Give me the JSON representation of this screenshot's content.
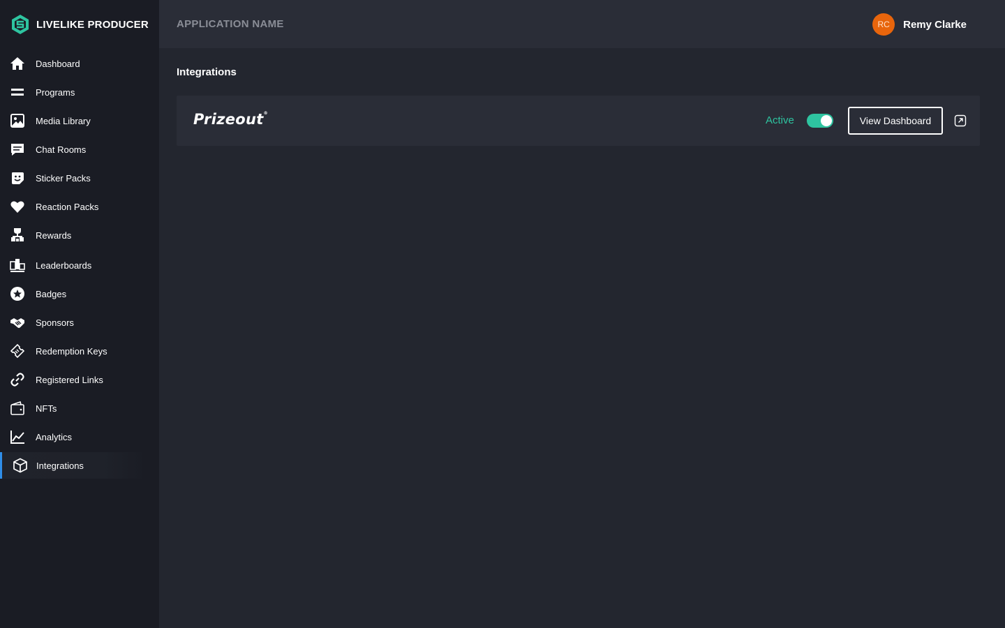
{
  "brand": {
    "name": "LIVELIKE PRODUCER",
    "accent": "#2ec4a0"
  },
  "header": {
    "app_name": "APPLICATION NAME",
    "user_initials": "RC",
    "user_name": "Remy Clarke",
    "avatar_color": "#e8650c"
  },
  "sidebar": {
    "items": [
      {
        "label": "Dashboard",
        "icon": "home-icon"
      },
      {
        "label": "Programs",
        "icon": "programs-icon"
      },
      {
        "label": "Media Library",
        "icon": "image-icon"
      },
      {
        "label": "Chat Rooms",
        "icon": "chat-icon"
      },
      {
        "label": "Sticker Packs",
        "icon": "sticker-icon"
      },
      {
        "label": "Reaction Packs",
        "icon": "heart-icon"
      },
      {
        "label": "Rewards",
        "icon": "rewards-icon"
      },
      {
        "label": "Leaderboards",
        "icon": "leaderboard-icon"
      },
      {
        "label": "Badges",
        "icon": "badge-icon"
      },
      {
        "label": "Sponsors",
        "icon": "handshake-icon"
      },
      {
        "label": "Redemption Keys",
        "icon": "ticket-icon"
      },
      {
        "label": "Registered Links",
        "icon": "link-icon"
      },
      {
        "label": "NFTs",
        "icon": "wallet-icon"
      },
      {
        "label": "Analytics",
        "icon": "chart-line-icon"
      },
      {
        "label": "Integrations",
        "icon": "cube-icon",
        "active": true
      }
    ]
  },
  "main": {
    "title": "Integrations",
    "integration": {
      "name": "Prizeout",
      "status": "Active",
      "enabled": true,
      "button_label": "View Dashboard",
      "status_color": "#2ec4a0"
    }
  }
}
